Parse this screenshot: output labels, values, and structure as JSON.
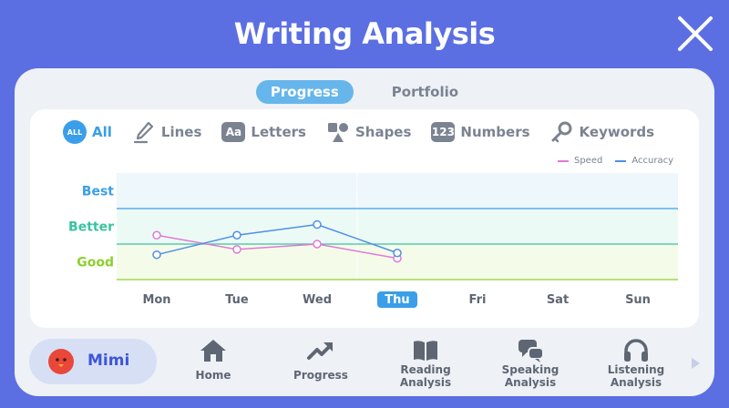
{
  "window": {
    "title": "Writing Analysis"
  },
  "tabs": [
    {
      "label": "Progress",
      "active": true
    },
    {
      "label": "Portfolio",
      "active": false
    }
  ],
  "filters": [
    {
      "label": "All",
      "icon": "all-badge-icon",
      "badge": "ALL",
      "active": true
    },
    {
      "label": "Lines",
      "icon": "pen-icon",
      "active": false
    },
    {
      "label": "Letters",
      "icon": "letters-icon",
      "badge": "Aa",
      "active": false
    },
    {
      "label": "Shapes",
      "icon": "shapes-icon",
      "active": false
    },
    {
      "label": "Numbers",
      "icon": "numbers-icon",
      "badge": "123",
      "active": false
    },
    {
      "label": "Keywords",
      "icon": "key-icon",
      "active": false
    }
  ],
  "colors": {
    "background": "#5b6fe3",
    "accent": "#3b9ee8",
    "speed": "#e07ad6",
    "accuracy": "#4f8fe6",
    "best": "#3b9ee8",
    "better": "#38c3a0",
    "good": "#8ccf2e"
  },
  "chart_data": {
    "type": "line",
    "categories": [
      "Mon",
      "Tue",
      "Wed",
      "Thu",
      "Fri",
      "Sat",
      "Sun"
    ],
    "highlighted_category": "Thu",
    "y_levels": [
      "Good",
      "Better",
      "Best"
    ],
    "ylim": [
      0,
      3
    ],
    "series": [
      {
        "name": "Speed",
        "values": [
          1.25,
          0.85,
          1.0,
          0.6,
          null,
          null,
          null
        ]
      },
      {
        "name": "Accuracy",
        "values": [
          0.7,
          1.25,
          1.55,
          0.75,
          null,
          null,
          null
        ]
      }
    ],
    "legend": "top-right",
    "grid": false
  },
  "user": {
    "name": "Mimi"
  },
  "nav": [
    {
      "label": "Home",
      "icon": "home-icon"
    },
    {
      "label": "Progress",
      "icon": "trend-arrow-icon"
    },
    {
      "label": "Reading Analysis",
      "icon": "book-icon"
    },
    {
      "label": "Speaking Analysis",
      "icon": "speech-bubbles-icon"
    },
    {
      "label": "Listening Analysis",
      "icon": "headphones-icon"
    }
  ]
}
